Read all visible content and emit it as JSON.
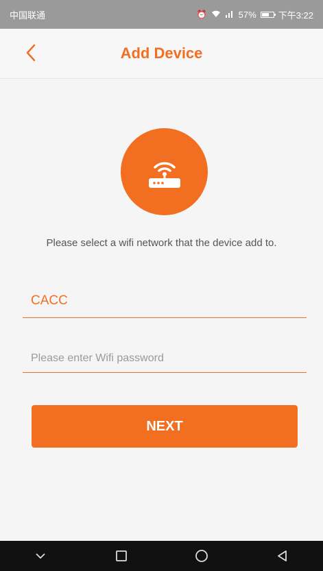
{
  "status_bar": {
    "carrier": "中国联通",
    "battery": "57%",
    "time": "下午3:22"
  },
  "header": {
    "title": "Add Device"
  },
  "main": {
    "instruction": "Please select a wifi network that the device add to.",
    "ssid_value": "CACC",
    "password_placeholder": "Please enter Wifi password",
    "next_label": "NEXT"
  },
  "colors": {
    "accent": "#f26f22",
    "background": "#f5f5f5",
    "navbar": "#111111"
  },
  "icons": [
    "chevron-left-icon",
    "router-wifi-icon",
    "alarm-icon",
    "wifi-icon",
    "signal-icon",
    "battery-icon",
    "nav-down-icon",
    "nav-square-icon",
    "nav-circle-icon",
    "nav-back-icon"
  ]
}
